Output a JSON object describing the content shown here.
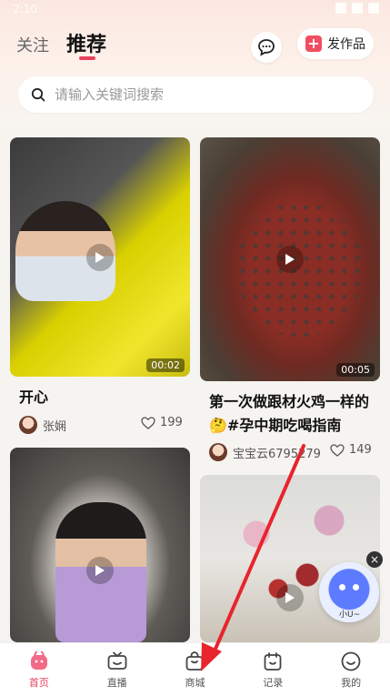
{
  "status_bar": {
    "time": "2:10"
  },
  "header": {
    "tabs": [
      {
        "label": "关注"
      },
      {
        "label": "推荐",
        "active": true
      }
    ],
    "post_button_label": "发作品",
    "accent_color": "#e8425c"
  },
  "search": {
    "placeholder": "请输入关键词搜索"
  },
  "feed": {
    "cards": [
      {
        "title": "开心",
        "duration": "00:02",
        "author": "张娴",
        "likes": "199"
      },
      {
        "title": "第一次做跟材火鸡一样的🤔#孕中期吃喝指南",
        "duration": "00:05",
        "author": "宝宝云6795279",
        "likes": "149"
      },
      {
        "title": "",
        "duration": "",
        "author": "",
        "likes": ""
      },
      {
        "title": "",
        "duration": "",
        "author": "",
        "likes": ""
      }
    ]
  },
  "floating_bot": {
    "label": "小U~"
  },
  "bottom_nav": {
    "items": [
      {
        "label": "首页",
        "icon": "home-icon",
        "active": true
      },
      {
        "label": "直播",
        "icon": "live-tv-icon"
      },
      {
        "label": "商城",
        "icon": "shopping-bag-icon"
      },
      {
        "label": "记录",
        "icon": "calendar-icon"
      },
      {
        "label": "我的",
        "icon": "smile-icon"
      }
    ]
  },
  "annotation": {
    "color": "#e8242c",
    "points_to": "商城"
  }
}
